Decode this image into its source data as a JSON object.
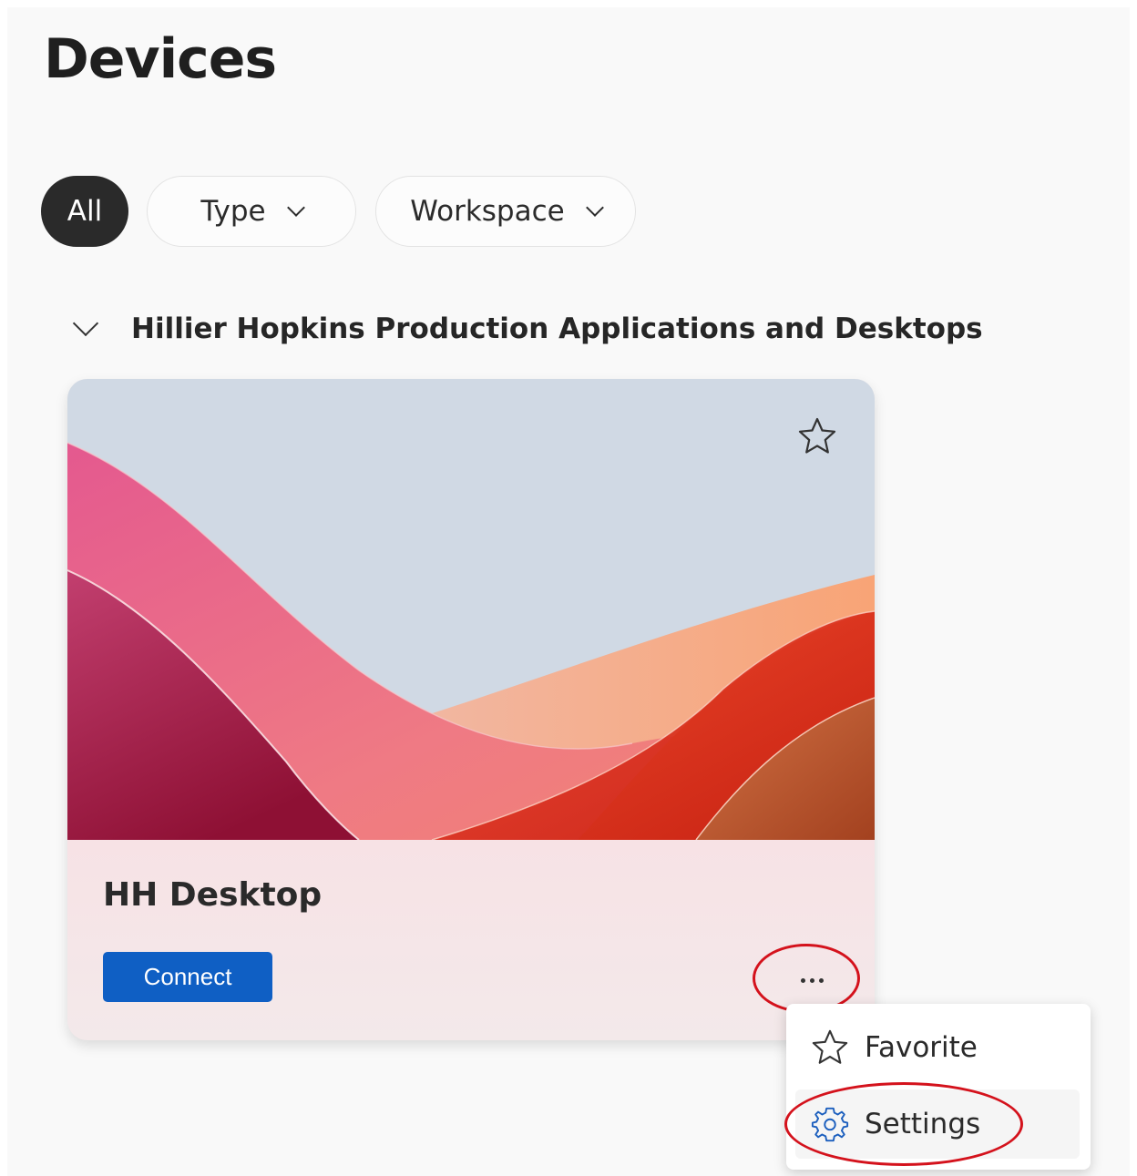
{
  "page": {
    "title": "Devices"
  },
  "filters": [
    {
      "label": "All",
      "active": true
    },
    {
      "label": "Type",
      "active": false
    },
    {
      "label": "Workspace",
      "active": false
    }
  ],
  "group": {
    "title": "Hillier Hopkins Production Applications and Desktops"
  },
  "device_card": {
    "name": "HH Desktop",
    "connect_label": "Connect",
    "favorite_icon": "star-icon",
    "more_icon": "more-options-icon"
  },
  "context_menu": {
    "items": [
      {
        "label": "Favorite",
        "icon": "star-icon"
      },
      {
        "label": "Settings",
        "icon": "gear-icon"
      }
    ]
  },
  "colors": {
    "accent": "#0f5fc4",
    "annotation": "#d4121c",
    "pill_active": "#2a2a2a"
  }
}
